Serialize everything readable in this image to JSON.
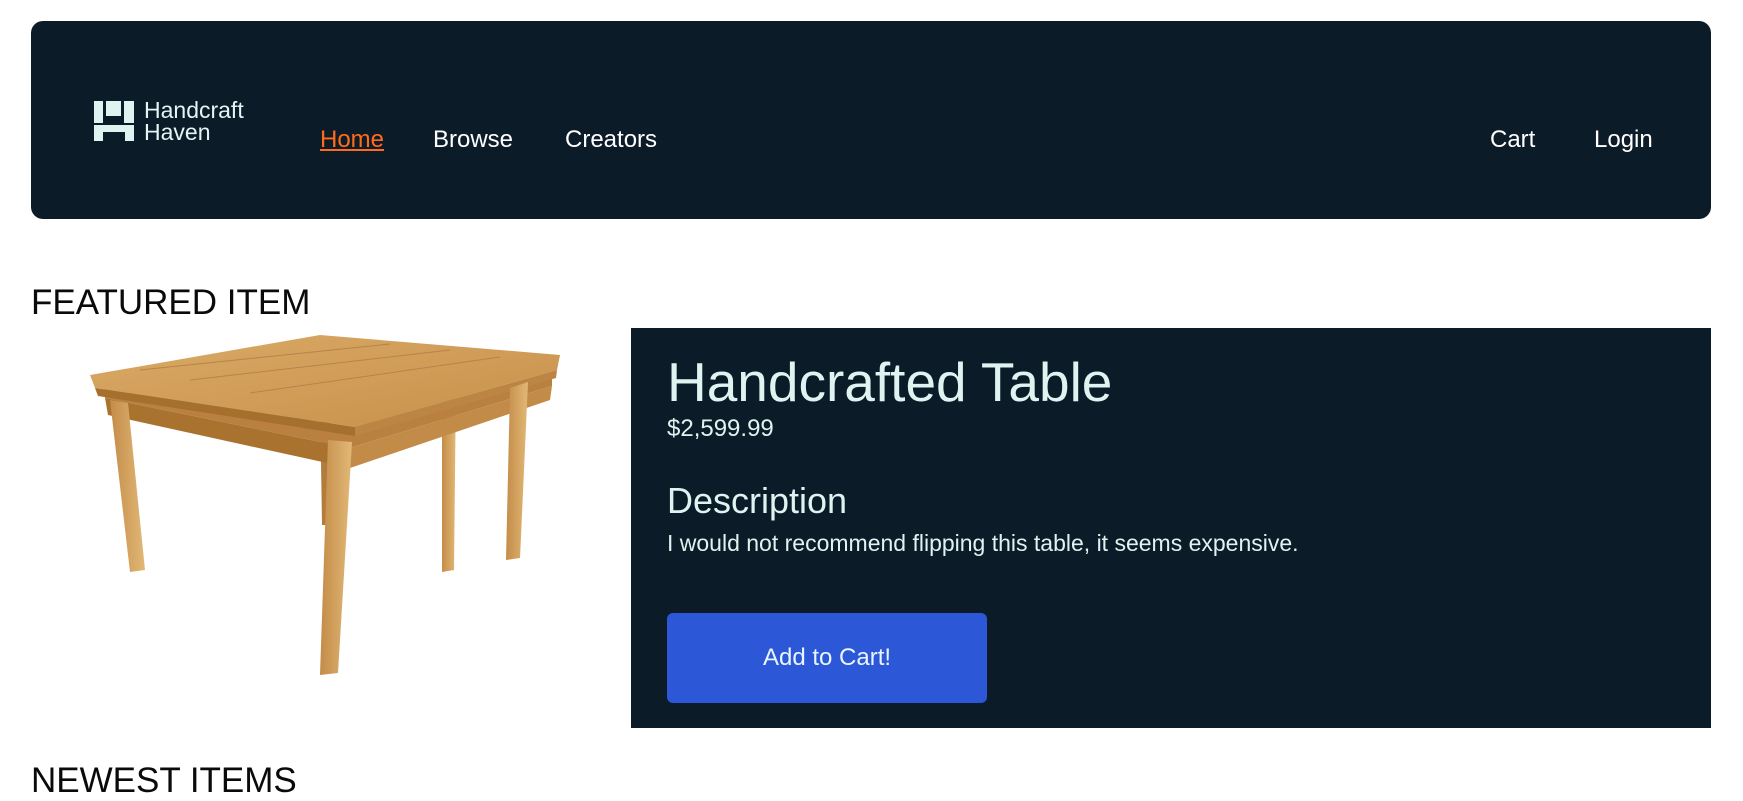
{
  "header": {
    "logo_icon": "handcraft-haven-logo-icon",
    "logo_line1": "Handcraft",
    "logo_line2": "Haven",
    "nav": {
      "home": "Home",
      "browse": "Browse",
      "creators": "Creators",
      "cart": "Cart",
      "login": "Login"
    },
    "active_link": "Home",
    "active_color": "#ff6b1a"
  },
  "featured": {
    "section_title": "FEATURED ITEM",
    "product_name": "Handcrafted Table",
    "price": "$2,599.99",
    "description_heading": "Description",
    "description": "I would not recommend flipping this table, it seems expensive.",
    "add_to_cart_label": "Add to Cart!",
    "image": "wooden-table-image"
  },
  "newest": {
    "section_title": "NEWEST ITEMS"
  },
  "colors": {
    "panel_bg": "#0c1b28",
    "button_bg": "#2c58d8",
    "text_light": "#dff3f1"
  }
}
